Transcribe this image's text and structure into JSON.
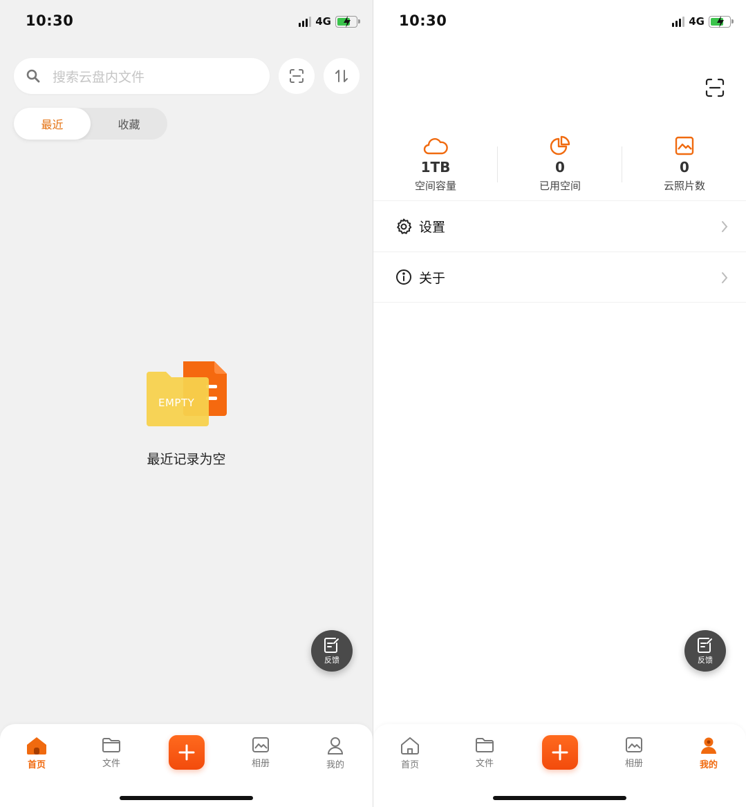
{
  "status": {
    "time": "10:30",
    "network": "4G"
  },
  "left": {
    "search": {
      "placeholder": "搜索云盘内文件"
    },
    "tabs": [
      {
        "label": "最近"
      },
      {
        "label": "收藏"
      }
    ],
    "empty": {
      "illustration_text": "EMPTY",
      "message": "最近记录为空"
    }
  },
  "right": {
    "stats": [
      {
        "value": "1TB",
        "label": "空间容量",
        "icon": "cloud-icon"
      },
      {
        "value": "0",
        "label": "已用空间",
        "icon": "pie-chart-icon"
      },
      {
        "value": "0",
        "label": "云照片数",
        "icon": "photo-icon"
      }
    ],
    "menu": [
      {
        "label": "设置",
        "icon": "gear-icon"
      },
      {
        "label": "关于",
        "icon": "info-icon"
      }
    ]
  },
  "feedback": {
    "label": "反馈"
  },
  "tabbar": {
    "items": [
      {
        "label": "首页",
        "icon": "home-icon"
      },
      {
        "label": "文件",
        "icon": "folder-icon"
      },
      {
        "label": "相册",
        "icon": "photo-icon"
      },
      {
        "label": "我的",
        "icon": "profile-icon"
      }
    ]
  },
  "colors": {
    "accent": "#f06a0f",
    "plus": "#f24b0c",
    "fab": "#4a4a4a",
    "left_bg": "#f1f1f1"
  }
}
